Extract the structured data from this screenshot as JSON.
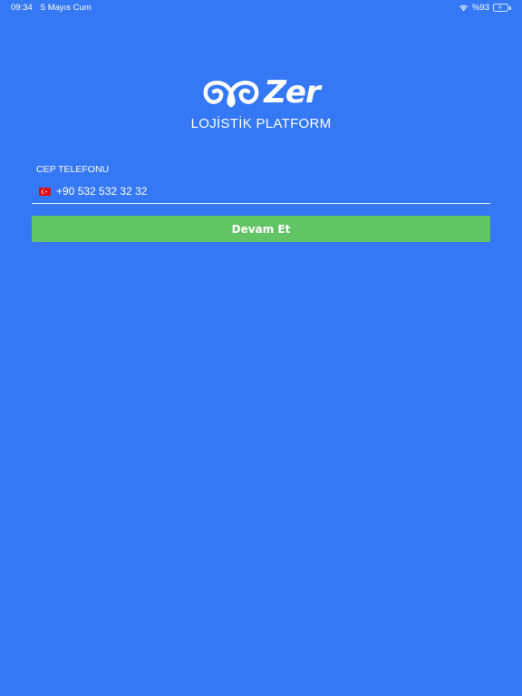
{
  "status_bar": {
    "time": "09:34",
    "date": "5 Mayıs Cum",
    "battery": "%93",
    "battery_level": 0.93,
    "wifi_icon": "wifi-icon",
    "battery_icon": "battery-charging-icon"
  },
  "brand": {
    "name": "Zer",
    "subtitle": "LOJİSTİK PLATFORM",
    "logo_icon": "zer-logo-mark"
  },
  "form": {
    "phone_label": "CEP TELEFONU",
    "phone_value": "+90 532 532 32 32",
    "country_flag_icon": "turkey-flag-icon",
    "continue_label": "Devam Et"
  },
  "colors": {
    "background": "#3478F6",
    "button": "#63C466",
    "text": "#FFFFFF"
  }
}
